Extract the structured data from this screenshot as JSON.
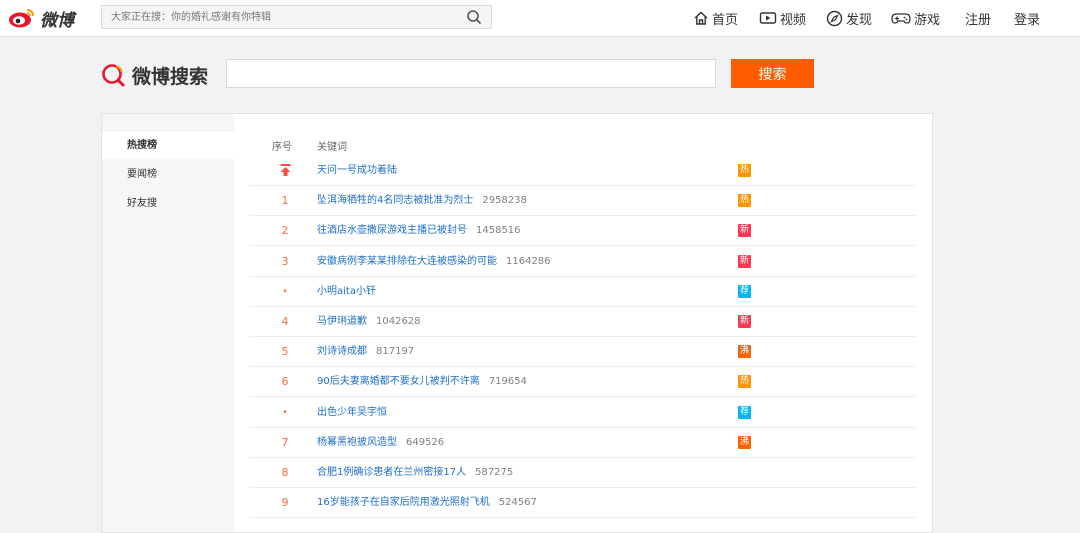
{
  "header": {
    "brand": "微博",
    "search_placeholder": "大家正在搜：你的婚礼感谢有你特辑",
    "nav": [
      {
        "label": "首页",
        "icon": "home-icon"
      },
      {
        "label": "视频",
        "icon": "video-icon"
      },
      {
        "label": "发现",
        "icon": "compass-icon"
      },
      {
        "label": "游戏",
        "icon": "gamepad-icon"
      },
      {
        "label": "注册",
        "icon": ""
      },
      {
        "label": "登录",
        "icon": ""
      }
    ]
  },
  "search": {
    "title": "微博搜索",
    "button": "搜索",
    "value": ""
  },
  "sidebar": {
    "items": [
      {
        "label": "热搜榜",
        "active": true
      },
      {
        "label": "要闻榜",
        "active": false
      },
      {
        "label": "好友搜",
        "active": false
      }
    ]
  },
  "table": {
    "headers": {
      "rank": "序号",
      "keyword": "关键词"
    },
    "rows": [
      {
        "rank": "",
        "rank_type": "top",
        "keyword": "天问一号成功着陆",
        "count": "",
        "badge": "热",
        "badge_color": "#ff9406"
      },
      {
        "rank": "1",
        "rank_type": "num",
        "keyword": "坠洱海牺牲的4名同志被批准为烈士",
        "count": "2958238",
        "badge": "热",
        "badge_color": "#ff9406"
      },
      {
        "rank": "2",
        "rank_type": "num",
        "keyword": "往酒店水壶撒尿游戏主播已被封号",
        "count": "1458516",
        "badge": "新",
        "badge_color": "#ff3852"
      },
      {
        "rank": "3",
        "rank_type": "num",
        "keyword": "安徽病例李某某排除在大连被感染的可能",
        "count": "1164286",
        "badge": "新",
        "badge_color": "#ff3852"
      },
      {
        "rank": "•",
        "rank_type": "dot",
        "keyword": "小明aita小钎",
        "count": "",
        "badge": "荐",
        "badge_color": "#00b7ee"
      },
      {
        "rank": "4",
        "rank_type": "num",
        "keyword": "马伊琍道歉",
        "count": "1042628",
        "badge": "新",
        "badge_color": "#ff3852"
      },
      {
        "rank": "5",
        "rank_type": "num",
        "keyword": "刘诗诗成都",
        "count": "817197",
        "badge": "沸",
        "badge_color": "#f86400"
      },
      {
        "rank": "6",
        "rank_type": "num",
        "keyword": "90后夫妻离婚都不要女儿被判不许离",
        "count": "719654",
        "badge": "热",
        "badge_color": "#ff9406"
      },
      {
        "rank": "•",
        "rank_type": "dot",
        "keyword": "出色少年吴宇恒",
        "count": "",
        "badge": "荐",
        "badge_color": "#00b7ee"
      },
      {
        "rank": "7",
        "rank_type": "num",
        "keyword": "杨幂黑袍披风造型",
        "count": "649526",
        "badge": "沸",
        "badge_color": "#f86400"
      },
      {
        "rank": "8",
        "rank_type": "num",
        "keyword": "合肥1例确诊患者在兰州密接17人",
        "count": "587275",
        "badge": "",
        "badge_color": ""
      },
      {
        "rank": "9",
        "rank_type": "num",
        "keyword": "16岁能孩子在自家后院用激光照射飞机",
        "count": "524567",
        "badge": "",
        "badge_color": ""
      }
    ]
  }
}
